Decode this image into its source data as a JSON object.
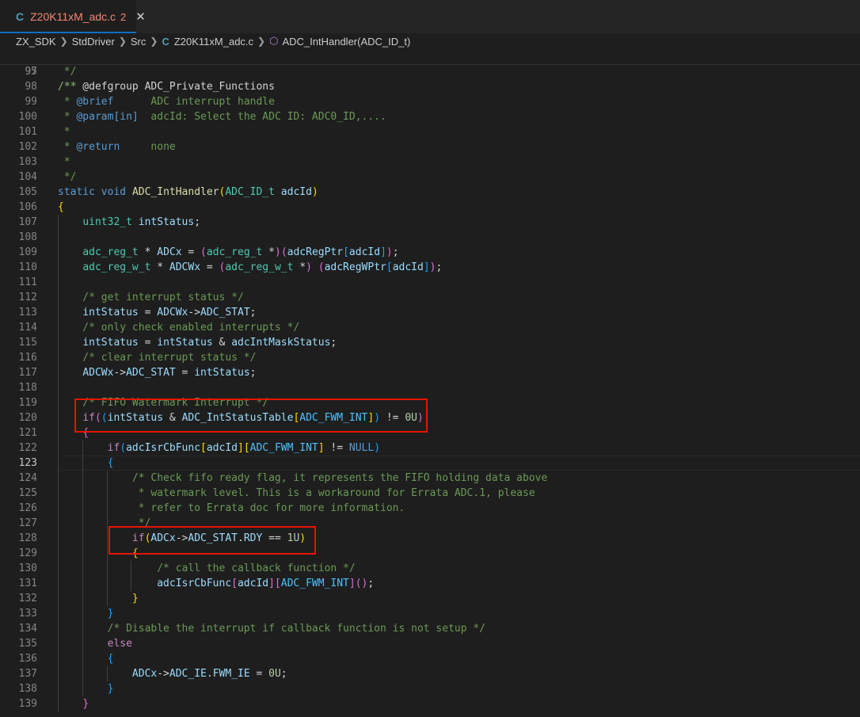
{
  "tab": {
    "title": "Z20K11xM_adc.c",
    "problems": "2",
    "lang_icon": "C",
    "close_glyph": "✕"
  },
  "breadcrumb": {
    "items": [
      "ZX_SDK",
      "StdDriver",
      "Src",
      "Z20K11xM_adc.c",
      "ADC_IntHandler(ADC_ID_t)"
    ],
    "lang_icon": "C"
  },
  "sticky": {
    "number": "95",
    "code": "/** @defgroup ADC_Private_Functions"
  },
  "active_line": "123",
  "lines": [
    {
      "n": "97",
      "c": " */"
    },
    {
      "n": "98",
      "c": "/**"
    },
    {
      "n": "99",
      "c": " * @brief      ADC interrupt handle"
    },
    {
      "n": "100",
      "c": " * @param[in]  adcId: Select the ADC ID: ADC0_ID,...."
    },
    {
      "n": "101",
      "c": " *"
    },
    {
      "n": "102",
      "c": " * @return     none"
    },
    {
      "n": "103",
      "c": " *"
    },
    {
      "n": "104",
      "c": " */"
    },
    {
      "n": "105",
      "c": "static void ADC_IntHandler(ADC_ID_t adcId)"
    },
    {
      "n": "106",
      "c": "{"
    },
    {
      "n": "107",
      "c": "    uint32_t intStatus;"
    },
    {
      "n": "108",
      "c": ""
    },
    {
      "n": "109",
      "c": "    adc_reg_t * ADCx = (adc_reg_t *)(adcRegPtr[adcId]);"
    },
    {
      "n": "110",
      "c": "    adc_reg_w_t * ADCWx = (adc_reg_w_t *) (adcRegWPtr[adcId]);"
    },
    {
      "n": "111",
      "c": ""
    },
    {
      "n": "112",
      "c": "    /* get interrupt status */"
    },
    {
      "n": "113",
      "c": "    intStatus = ADCWx->ADC_STAT;"
    },
    {
      "n": "114",
      "c": "    /* only check enabled interrupts */"
    },
    {
      "n": "115",
      "c": "    intStatus = intStatus & adcIntMaskStatus;"
    },
    {
      "n": "116",
      "c": "    /* clear interrupt status */"
    },
    {
      "n": "117",
      "c": "    ADCWx->ADC_STAT = intStatus;"
    },
    {
      "n": "118",
      "c": ""
    },
    {
      "n": "119",
      "c": "    /* FIFO Watermark Interrupt */"
    },
    {
      "n": "120",
      "c": "    if((intStatus & ADC_IntStatusTable[ADC_FWM_INT]) != 0U)"
    },
    {
      "n": "121",
      "c": "    {"
    },
    {
      "n": "122",
      "c": "        if(adcIsrCbFunc[adcId][ADC_FWM_INT] != NULL)"
    },
    {
      "n": "123",
      "c": "        {"
    },
    {
      "n": "124",
      "c": "            /* Check fifo ready flag, it represents the FIFO holding data above"
    },
    {
      "n": "125",
      "c": "             * watermark level. This is a workaround for Errata ADC.1, please"
    },
    {
      "n": "126",
      "c": "             * refer to Errata doc for more information."
    },
    {
      "n": "127",
      "c": "             */"
    },
    {
      "n": "128",
      "c": "            if(ADCx->ADC_STAT.RDY == 1U)"
    },
    {
      "n": "129",
      "c": "            {"
    },
    {
      "n": "130",
      "c": "                /* call the callback function */"
    },
    {
      "n": "131",
      "c": "                adcIsrCbFunc[adcId][ADC_FWM_INT]();"
    },
    {
      "n": "132",
      "c": "            }"
    },
    {
      "n": "133",
      "c": "        }"
    },
    {
      "n": "134",
      "c": "        /* Disable the interrupt if callback function is not setup */"
    },
    {
      "n": "135",
      "c": "        else"
    },
    {
      "n": "136",
      "c": "        {"
    },
    {
      "n": "137",
      "c": "            ADCx->ADC_IE.FWM_IE = 0U;"
    },
    {
      "n": "138",
      "c": "        }"
    },
    {
      "n": "139",
      "c": "    }"
    }
  ],
  "colors": {
    "background": "#1e1e1e",
    "highlight_box": "#e51400",
    "tab_accent": "#0e70c0"
  }
}
